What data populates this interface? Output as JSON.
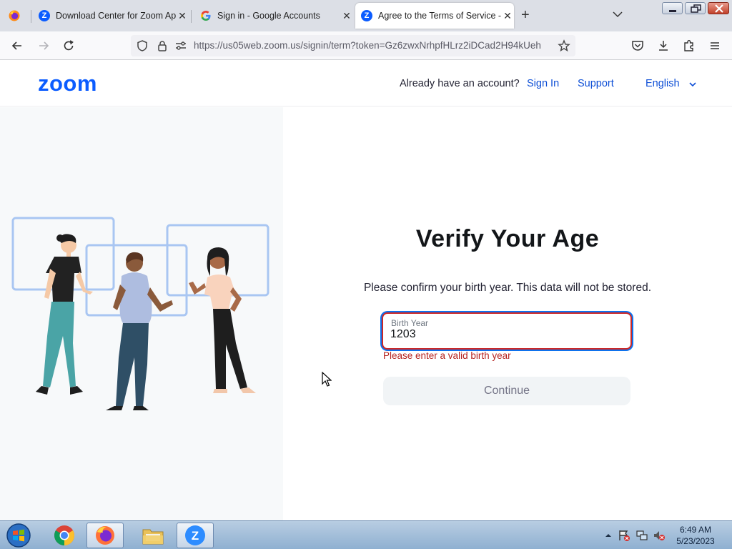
{
  "browser": {
    "tabs": [
      {
        "title": "Download Center for Zoom Ap",
        "favicon": "zoom-favicon"
      },
      {
        "title": "Sign in - Google Accounts",
        "favicon": "google-favicon"
      },
      {
        "title": "Agree to the Terms of Service -",
        "favicon": "zoom-favicon",
        "active": true
      }
    ],
    "url": "https://us05web.zoom.us/signin/term?token=Gz6zwxNrhpfHLrz2iDCad2H94kUeh"
  },
  "header": {
    "logo": "zoom",
    "question": "Already have an account?",
    "sign_in": "Sign In",
    "support": "Support",
    "language": "English"
  },
  "main": {
    "title": "Verify Your Age",
    "subtitle": "Please confirm your birth year. This data will not be stored.",
    "birth_year_label": "Birth Year",
    "birth_year_value": "1203",
    "error": "Please enter a valid birth year",
    "continue_label": "Continue"
  },
  "taskbar": {
    "apps": [
      "chrome-icon",
      "firefox-icon",
      "file-explorer-icon",
      "zoom-icon"
    ],
    "time": "6:49 AM",
    "date": "5/23/2023"
  },
  "colors": {
    "zoom_blue": "#0b5cff",
    "link_blue": "#0e4fd6",
    "error_red": "#b6231f",
    "focus_blue": "#0e72ed"
  }
}
